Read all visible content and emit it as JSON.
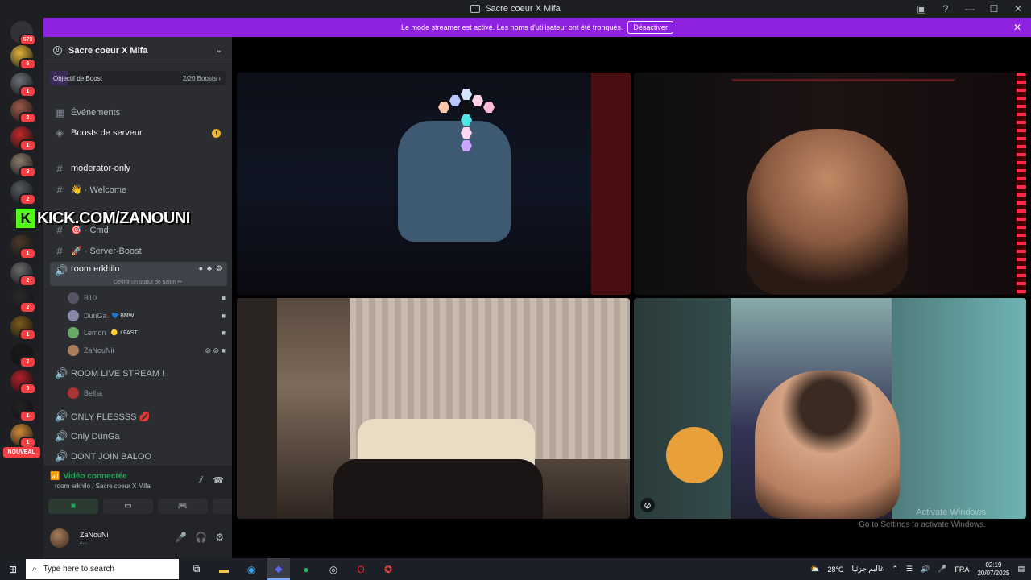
{
  "window": {
    "title": "Sacre coeur X Mifa"
  },
  "banner": {
    "text": "Le mode streamer est activé. Les noms d'utilisateur ont été tronqués.",
    "disable_label": "Désactiver"
  },
  "rail": {
    "home_badge": "679",
    "new_label": "NOUVEAU",
    "servers": [
      {
        "badge": "6",
        "color": "#e0b43a"
      },
      {
        "badge": "1",
        "color": "#6b6f77"
      },
      {
        "badge": "2",
        "color": "#9a5a4a"
      },
      {
        "badge": "1",
        "color": "#c02a2a"
      },
      {
        "badge": "9",
        "color": "#8a7a6a"
      },
      {
        "badge": "2",
        "color": "#555a60"
      },
      {
        "badge": "",
        "color": "#333"
      },
      {
        "badge": "1",
        "color": "#4a3a2a"
      },
      {
        "badge": "2",
        "color": "#6a6a6a"
      },
      {
        "badge": "2",
        "color": "#2a2a2a"
      },
      {
        "badge": "1",
        "color": "#7a5a1a"
      },
      {
        "badge": "2",
        "color": "#1a1a1a"
      },
      {
        "badge": "5",
        "color": "#b0202a"
      },
      {
        "badge": "1",
        "color": "#222"
      },
      {
        "badge": "1",
        "color": "#d08a3a"
      }
    ]
  },
  "server": {
    "name": "Sacre coeur X Mifa",
    "boost_goal_label": "Objectif de Boost",
    "boost_progress": "2/20 Boosts",
    "boost_fraction": 0.1
  },
  "channels": {
    "events": "Événements",
    "server_boosts": "Boosts de serveur",
    "moderator": "moderator-only",
    "welcome": "👋 · Welcome",
    "cmd": "🎯 · Cmd",
    "server_boost": "🚀 · Server-Boost",
    "room_erkhilo": "room erkhilo",
    "room_status": "Définir un statut de salon ✏",
    "room_live": "ROOM LIVE STREAM !",
    "only_flessss": "ONLY FLESSSS 💋",
    "only_dunga": "Only DunGa",
    "dont_join": "DONT JOIN BALOO"
  },
  "members": {
    "m1": "B10",
    "m2": "DunGa",
    "m2_tag": "💙 BMW",
    "m3": "Lemon",
    "m3_tag": "🟡 ⚡FAST",
    "m4": "ZaNouNii",
    "m5": "Belha"
  },
  "voice": {
    "status": "Vidéo connectée",
    "location": "room erkhilo / Sacre coeur X Mifa"
  },
  "user": {
    "name": "ZaNouNi",
    "status": "z..."
  },
  "overlay": {
    "k": "K",
    "url": "KICK.COM/ZANOUNI"
  },
  "watermark": {
    "line1": "Activate Windows",
    "line2": "Go to Settings to activate Windows."
  },
  "taskbar": {
    "search_placeholder": "Type here to search",
    "weather": "28°C",
    "weather_text": "غالبم جزئيا",
    "lang": "FRA",
    "time": "02:19",
    "date": "20/07/2025"
  }
}
